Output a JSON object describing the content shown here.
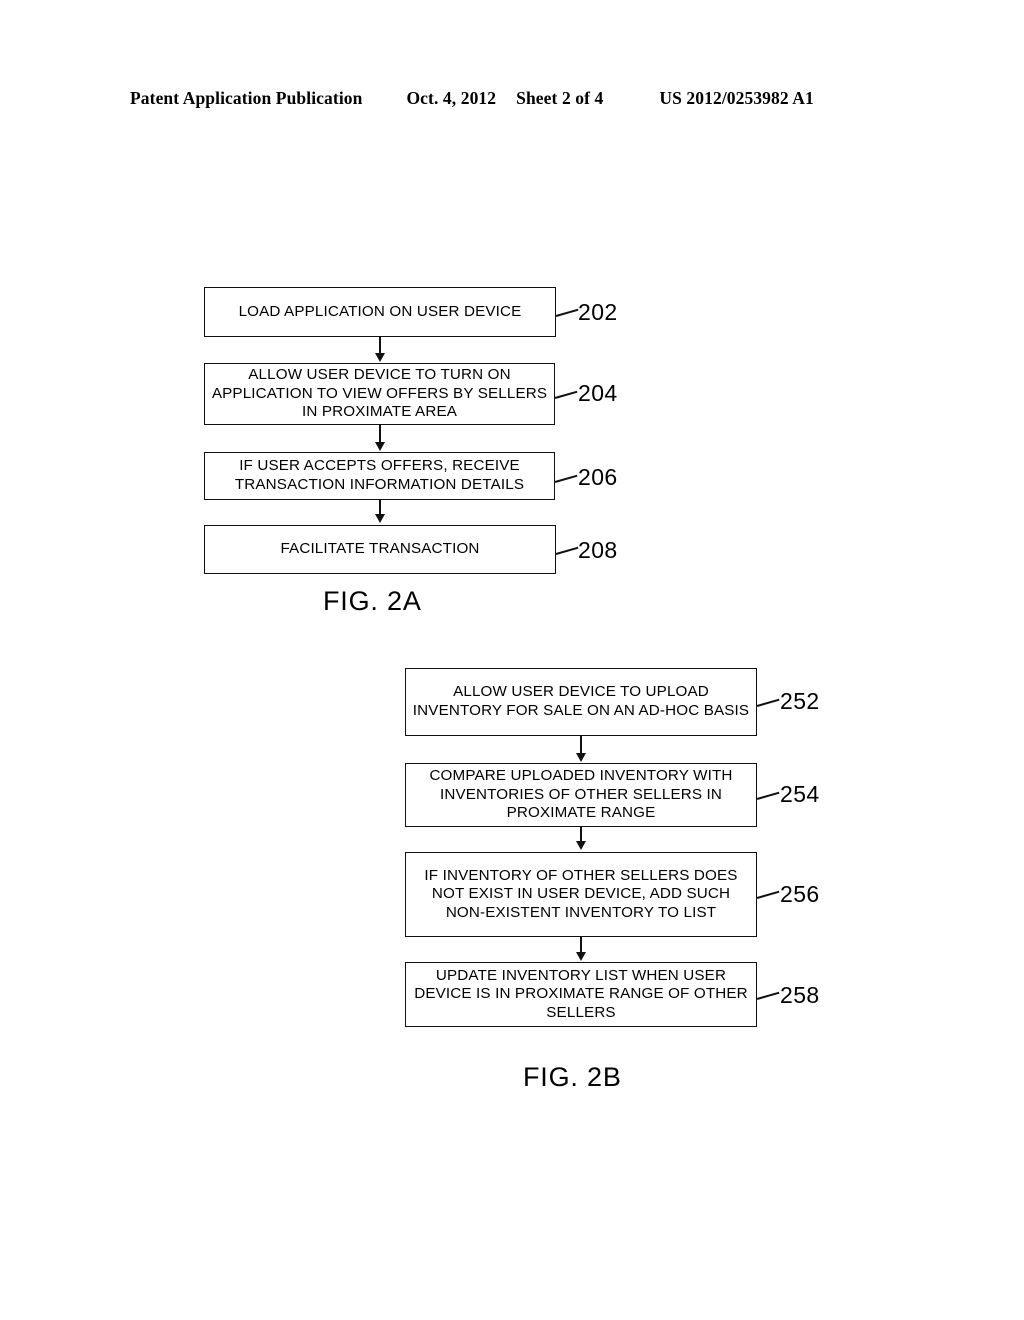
{
  "header": {
    "publication": "Patent Application Publication",
    "date": "Oct. 4, 2012",
    "sheet": "Sheet 2 of 4",
    "patent_number": "US 2012/0253982 A1"
  },
  "figures": [
    {
      "caption": "FIG. 2A",
      "steps": [
        {
          "ref": "202",
          "text": "LOAD APPLICATION ON USER DEVICE"
        },
        {
          "ref": "204",
          "text": "ALLOW USER DEVICE TO TURN ON APPLICATION TO VIEW OFFERS BY SELLERS IN PROXIMATE AREA"
        },
        {
          "ref": "206",
          "text": "IF USER ACCEPTS OFFERS, RECEIVE TRANSACTION INFORMATION DETAILS"
        },
        {
          "ref": "208",
          "text": "FACILITATE TRANSACTION"
        }
      ]
    },
    {
      "caption": "FIG. 2B",
      "steps": [
        {
          "ref": "252",
          "text": "ALLOW USER DEVICE TO UPLOAD INVENTORY FOR SALE ON AN AD-HOC BASIS"
        },
        {
          "ref": "254",
          "text": "COMPARE UPLOADED INVENTORY WITH INVENTORIES OF OTHER SELLERS IN PROXIMATE RANGE"
        },
        {
          "ref": "256",
          "text": "IF INVENTORY OF OTHER SELLERS DOES NOT EXIST IN USER DEVICE, ADD SUCH NON-EXISTENT INVENTORY TO LIST"
        },
        {
          "ref": "258",
          "text": "UPDATE INVENTORY LIST WHEN USER DEVICE IS IN PROXIMATE RANGE OF OTHER SELLERS"
        }
      ]
    }
  ]
}
